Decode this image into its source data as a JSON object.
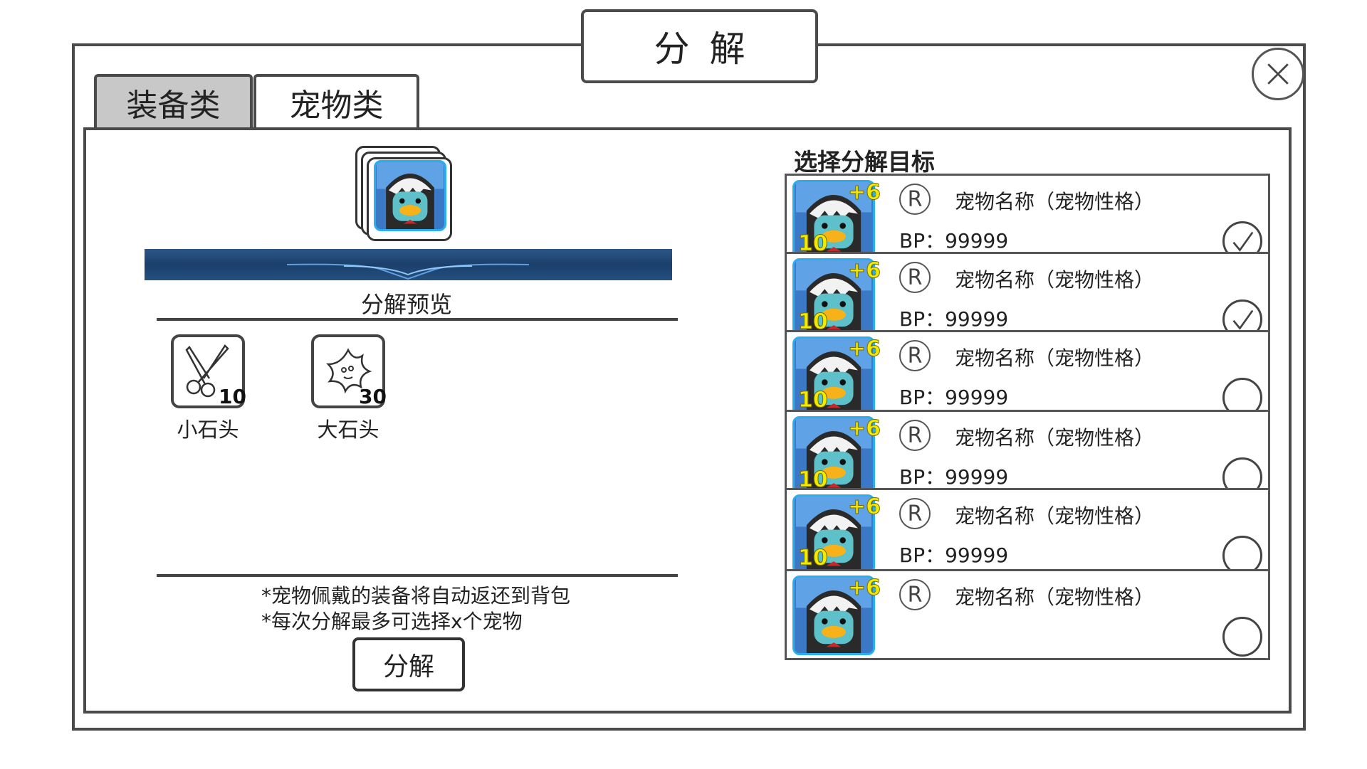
{
  "window": {
    "title": "分解",
    "close_icon": "close-icon"
  },
  "tabs": [
    {
      "label": "装备类",
      "active": true
    },
    {
      "label": "宠物类",
      "active": false
    }
  ],
  "preview": {
    "label": "分解预览",
    "materials": [
      {
        "name": "小石头",
        "count": "10",
        "icon": "scissors-icon"
      },
      {
        "name": "大石头",
        "count": "30",
        "icon": "star-blob-icon"
      }
    ],
    "notes": [
      "*宠物佩戴的装备将自动返还到背包",
      "*每次分解最多可选择x个宠物"
    ],
    "action_button": "分解"
  },
  "target_list": {
    "title": "选择分解目标",
    "items": [
      {
        "plus": "+6",
        "level": "10",
        "rarity": "R",
        "name": "宠物名称（宠物性格）",
        "bp": "BP：99999",
        "selected": true
      },
      {
        "plus": "+6",
        "level": "10",
        "rarity": "R",
        "name": "宠物名称（宠物性格）",
        "bp": "BP：99999",
        "selected": true
      },
      {
        "plus": "+6",
        "level": "10",
        "rarity": "R",
        "name": "宠物名称（宠物性格）",
        "bp": "BP：99999",
        "selected": false
      },
      {
        "plus": "+6",
        "level": "10",
        "rarity": "R",
        "name": "宠物名称（宠物性格）",
        "bp": "BP：99999",
        "selected": false
      },
      {
        "plus": "+6",
        "level": "10",
        "rarity": "R",
        "name": "宠物名称（宠物性格）",
        "bp": "BP：99999",
        "selected": false
      },
      {
        "plus": "+6",
        "level": "",
        "rarity": "R",
        "name": "宠物名称（宠物性格）",
        "bp": "",
        "selected": false
      }
    ]
  },
  "colors": {
    "active_tab": "#c8c8c8",
    "border": "#4a4a4a",
    "level_text": "#f2ea00",
    "banner": "#1c3f6b"
  }
}
